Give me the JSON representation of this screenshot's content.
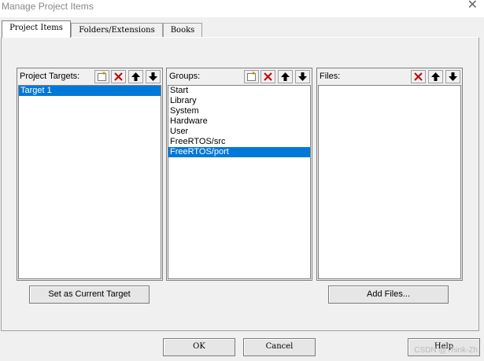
{
  "window": {
    "title": "Manage Project Items",
    "close_glyph": "✕"
  },
  "tabs": [
    {
      "label": "Project Items",
      "active": true
    },
    {
      "label": "Folders/Extensions",
      "active": false
    },
    {
      "label": "Books",
      "active": false
    }
  ],
  "targets": {
    "label": "Project Targets:",
    "items": [
      "Target 1"
    ],
    "selected": "Target 1",
    "button_label": "Set as Current Target"
  },
  "groups": {
    "label": "Groups:",
    "items": [
      "Start",
      "Library",
      "System",
      "Hardware",
      "User",
      "FreeRTOS/src",
      "FreeRTOS/port"
    ],
    "selected": "FreeRTOS/port"
  },
  "files": {
    "label": "Files:",
    "items": [],
    "button_label": "Add Files..."
  },
  "dialog_buttons": {
    "ok": "OK",
    "cancel": "Cancel",
    "help": "Help"
  },
  "watermark": "CSDN @Think-Zh",
  "colors": {
    "selection": "#0078d7",
    "delete_icon": "#c00000"
  },
  "icons": [
    "new-item-icon",
    "delete-icon",
    "move-up-icon",
    "move-down-icon"
  ]
}
